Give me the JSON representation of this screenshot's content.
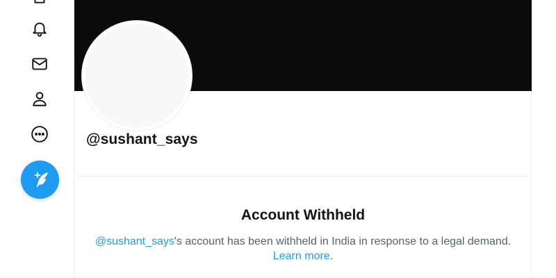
{
  "sidebar": {
    "icons": [
      "home-icon",
      "bell-icon",
      "mail-icon",
      "profile-icon",
      "more-icon"
    ],
    "compose_icon": "feather-plus-icon"
  },
  "profile": {
    "handle": "@sushant_says"
  },
  "withheld": {
    "title": "Account Withheld",
    "link_handle": "@sushant_says",
    "message": "'s account has been withheld in India in response to a legal demand.",
    "learn_more": "Learn more",
    "period": "."
  },
  "colors": {
    "accent": "#1d9bf0",
    "banner": "#0b0b0b",
    "text": "#0f1419",
    "muted": "#536471"
  }
}
